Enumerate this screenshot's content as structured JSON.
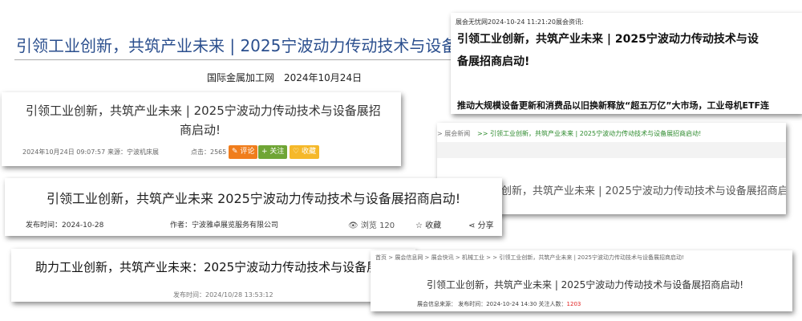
{
  "c1": {
    "title": "引领工业创新，共筑产业未来 | 2025宁波动力传动技术与设备",
    "source": "国际金属加工网",
    "date": "2024年10月24日"
  },
  "c2": {
    "title_line1": "引领工业创新，共筑产业未来 | 2025宁波动力传动技术与设备展招",
    "title_line2": "商启动!",
    "date": "2024年10月24日 09:07:57",
    "source": "来源：宁波机床展",
    "views": "点击：2565",
    "comment_btn": "评论",
    "follow_btn": "关注",
    "fav_btn": "收藏"
  },
  "c3": {
    "meta": "展会无忧网2024-10-24 11:21:20展会资讯:",
    "title_line1": "引领工业创新，共筑产业未来 | 2025宁波动力传动技术与设",
    "title_line2": "备展招商启动!",
    "related": "推动大规模设备更新和消费品以旧换新释放“超五万亿”大市场，工业母机ETF连"
  },
  "c4": {
    "breadcrumb_a": "> 展会新闻",
    "breadcrumb_b": ">> 引领工业创新，共筑产业未来 | 2025宁波动力传动技术与设备展招商启动!",
    "title": "创新，共筑产业未来 | 2025宁波动力传动技术与设备展招商启动!"
  },
  "c5": {
    "title": "引领工业创新，共筑产业未来 2025宁波动力传动技术与设备展招商启动!",
    "pub": "发布时间：2024-10-28",
    "author": "作者：宁波雅卓展览服务有限公司",
    "views": "浏览 120",
    "fav": "收藏",
    "share": "分享"
  },
  "c6": {
    "title": "助力工业创新，共筑产业未来：2025宁波动力传动技术与设备展",
    "pub": "发布时间：2024/10/28 13:53:12"
  },
  "c7": {
    "breadcrumb": "首页 > 展会信息网 > 展会快讯 > 机械工业 > > 引领工业创新，共筑产业未来 | 2025宁波动力传动技术与设备展招商启动!",
    "title": "引领工业创新，共筑产业未来 | 2025宁波动力传动技术与设备展招商启动!",
    "meta_prefix": "展会信息来源：   发布时间：2024-10-24 14:30 关注人数：",
    "views": "1203"
  },
  "colors": {
    "accent_blue": "#2b4f8e",
    "green_link": "#2e8b2e",
    "red_count": "#e02020"
  }
}
